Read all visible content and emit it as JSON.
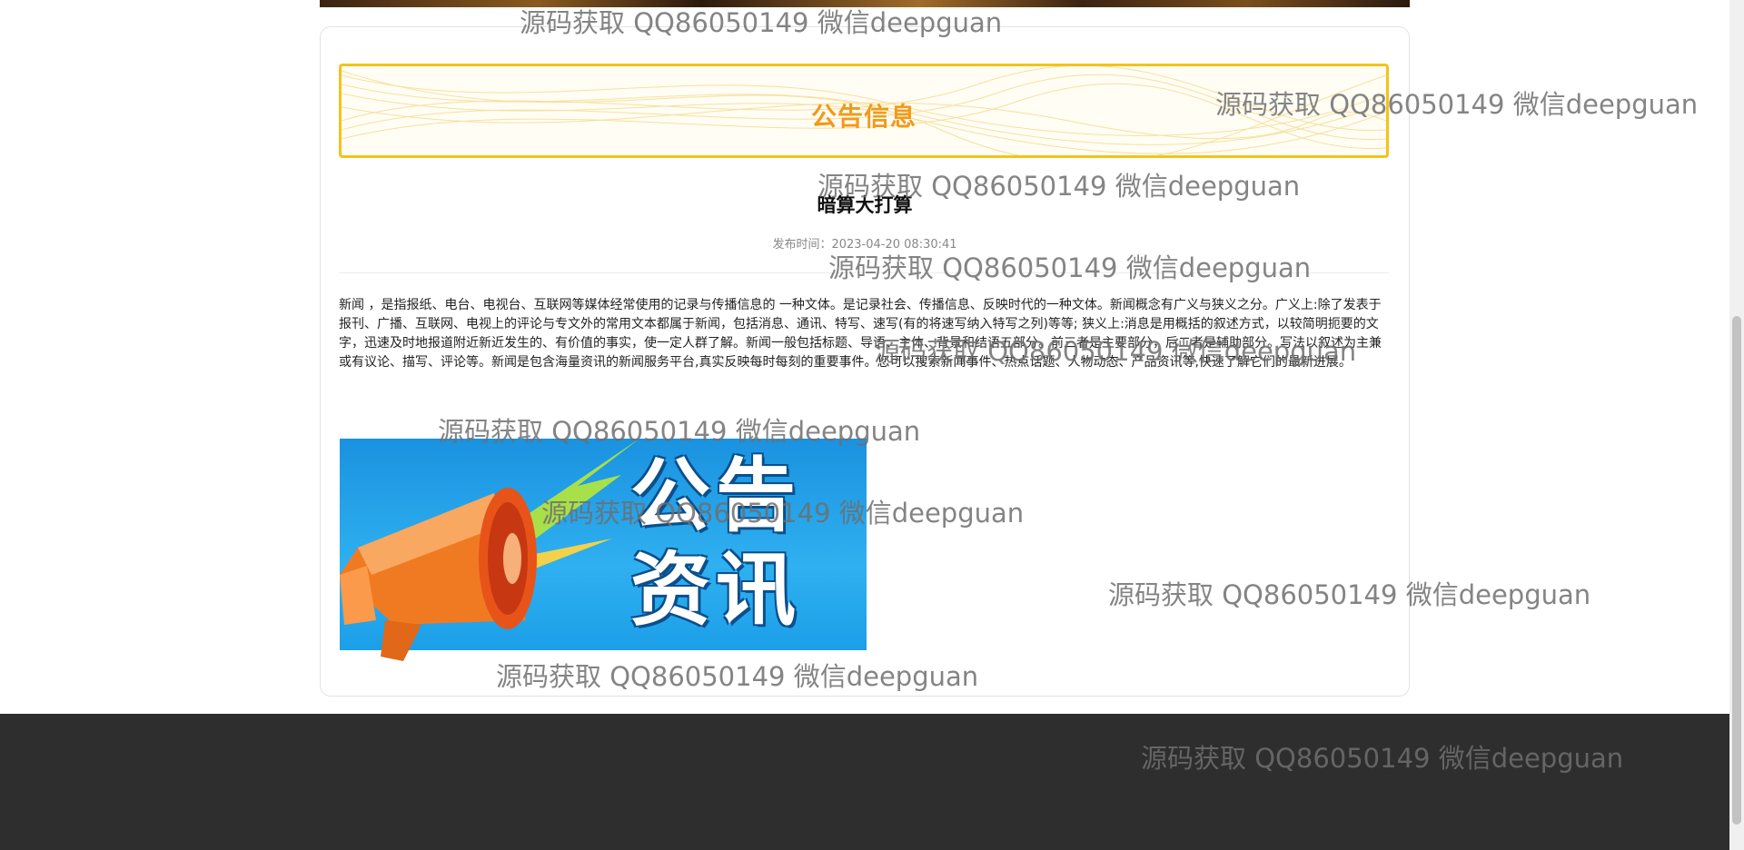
{
  "notice": {
    "header_title": "公告信息",
    "article_title": "暗算大打算",
    "meta_label": "发布时间：",
    "publish_time": "2023-04-20 08:30:41",
    "content": "新闻 ，是指报纸、电台、电视台、互联网等媒体经常使用的记录与传播信息的 一种文体。是记录社会、传播信息、反映时代的一种文体。新闻概念有广义与狭义之分。广义上:除了发表于报刊、广播、互联网、电视上的评论与专文外的常用文本都属于新闻，包括消息、通讯、特写、速写(有的将速写纳入特写之列)等等; 狭义上:消息是用概括的叙述方式，以较简明扼要的文字，迅速及时地报道附近新近发生的、有价值的事实，使一定人群了解。新闻一般包括标题、导语、主体、背景和结语五部分。前三者是主要部分，后二者是辅助部分。写法以叙述为主兼或有议论、描写、评论等。新闻是包含海量资讯的新闻服务平台,真实反映每时每刻的重要事件。您可以搜索新闻事件、热点话题、人物动态、产品资讯等,快速了解它们的最新进展。",
    "promo_image_text": "公告资讯"
  },
  "watermark": {
    "text": "源码获取 QQ86050149 微信deepguan"
  },
  "colors": {
    "header_title": "#f29a1a",
    "header_border": "#f3c31a",
    "footer_bg": "#2e2e2e",
    "promo_bg": "#2fb0f0"
  }
}
